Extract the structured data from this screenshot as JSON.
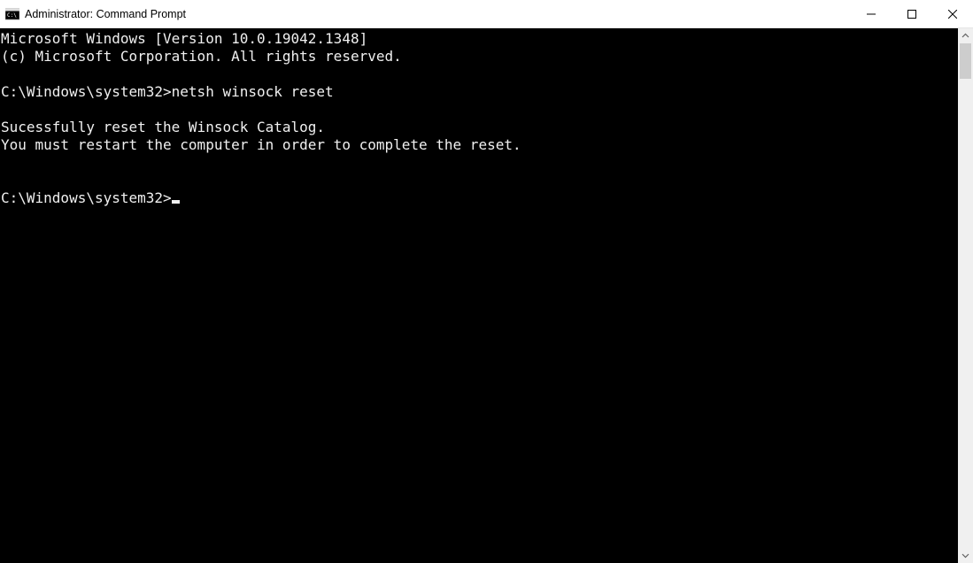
{
  "window": {
    "title": "Administrator: Command Prompt"
  },
  "terminal": {
    "line_version": "Microsoft Windows [Version 10.0.19042.1348]",
    "line_copyright": "(c) Microsoft Corporation. All rights reserved.",
    "prompt1": "C:\\Windows\\system32>",
    "command1": "netsh winsock reset",
    "line_success": "Sucessfully reset the Winsock Catalog.",
    "line_restart": "You must restart the computer in order to complete the reset.",
    "prompt2": "C:\\Windows\\system32>"
  }
}
